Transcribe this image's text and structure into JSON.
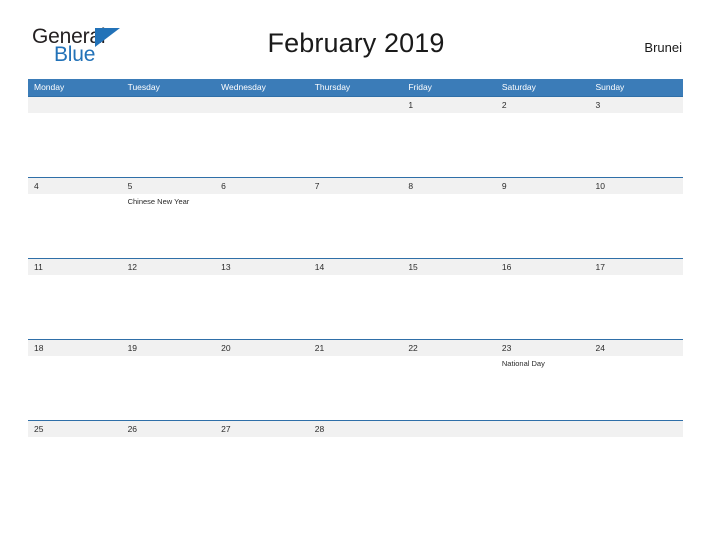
{
  "logo": {
    "word_one": "General",
    "word_two": "Blue",
    "triangle_color": "#2272b8",
    "text_color": "#231f20"
  },
  "header": {
    "title": "February 2019",
    "region": "Brunei"
  },
  "theme": {
    "header_blue": "#3b7cb8",
    "row_divider_blue": "#2f6fa8",
    "date_band_gray": "#f1f1f1",
    "page_background": "#ffffff"
  },
  "calendar": {
    "weekdays": [
      "Monday",
      "Tuesday",
      "Wednesday",
      "Thursday",
      "Friday",
      "Saturday",
      "Sunday"
    ],
    "weeks": [
      {
        "days": [
          {
            "date": "",
            "event": ""
          },
          {
            "date": "",
            "event": ""
          },
          {
            "date": "",
            "event": ""
          },
          {
            "date": "",
            "event": ""
          },
          {
            "date": "1",
            "event": ""
          },
          {
            "date": "2",
            "event": ""
          },
          {
            "date": "3",
            "event": ""
          }
        ]
      },
      {
        "days": [
          {
            "date": "4",
            "event": ""
          },
          {
            "date": "5",
            "event": "Chinese New Year"
          },
          {
            "date": "6",
            "event": ""
          },
          {
            "date": "7",
            "event": ""
          },
          {
            "date": "8",
            "event": ""
          },
          {
            "date": "9",
            "event": ""
          },
          {
            "date": "10",
            "event": ""
          }
        ]
      },
      {
        "days": [
          {
            "date": "11",
            "event": ""
          },
          {
            "date": "12",
            "event": ""
          },
          {
            "date": "13",
            "event": ""
          },
          {
            "date": "14",
            "event": ""
          },
          {
            "date": "15",
            "event": ""
          },
          {
            "date": "16",
            "event": ""
          },
          {
            "date": "17",
            "event": ""
          }
        ]
      },
      {
        "days": [
          {
            "date": "18",
            "event": ""
          },
          {
            "date": "19",
            "event": ""
          },
          {
            "date": "20",
            "event": ""
          },
          {
            "date": "21",
            "event": ""
          },
          {
            "date": "22",
            "event": ""
          },
          {
            "date": "23",
            "event": "National Day"
          },
          {
            "date": "24",
            "event": ""
          }
        ]
      },
      {
        "days": [
          {
            "date": "25",
            "event": ""
          },
          {
            "date": "26",
            "event": ""
          },
          {
            "date": "27",
            "event": ""
          },
          {
            "date": "28",
            "event": ""
          },
          {
            "date": "",
            "event": ""
          },
          {
            "date": "",
            "event": ""
          },
          {
            "date": "",
            "event": ""
          }
        ]
      }
    ]
  }
}
